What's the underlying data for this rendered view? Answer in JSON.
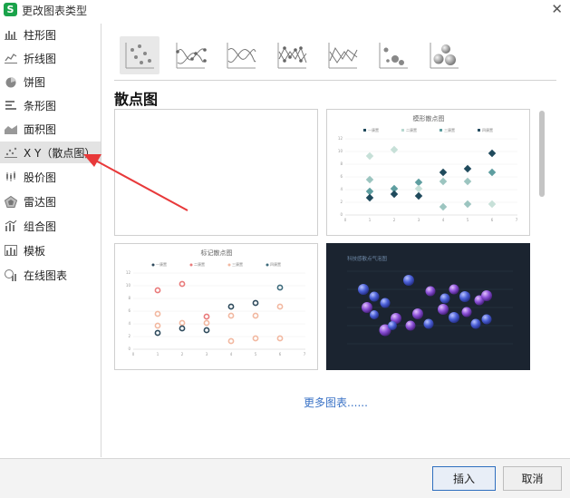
{
  "window": {
    "title": "更改图表类型",
    "app_icon": "S",
    "close_glyph": "✕"
  },
  "sidebar": {
    "items": [
      {
        "label": "柱形图",
        "icon": "column-chart-icon"
      },
      {
        "label": "折线图",
        "icon": "line-chart-icon"
      },
      {
        "label": "饼图",
        "icon": "pie-chart-icon"
      },
      {
        "label": "条形图",
        "icon": "bar-chart-icon"
      },
      {
        "label": "面积图",
        "icon": "area-chart-icon"
      },
      {
        "label": "X Y（散点图）",
        "icon": "scatter-chart-icon",
        "selected": true
      },
      {
        "label": "股价图",
        "icon": "stock-chart-icon"
      },
      {
        "label": "雷达图",
        "icon": "radar-chart-icon"
      },
      {
        "label": "组合图",
        "icon": "combo-chart-icon"
      },
      {
        "label": "模板",
        "icon": "template-icon"
      },
      {
        "label": "在线图表",
        "icon": "online-chart-icon"
      }
    ]
  },
  "chart_subtypes": [
    {
      "icon": "scatter-markers-icon",
      "selected": true
    },
    {
      "icon": "smooth-lines-markers-icon"
    },
    {
      "icon": "smooth-lines-icon"
    },
    {
      "icon": "straight-lines-markers-icon"
    },
    {
      "icon": "straight-lines-icon"
    },
    {
      "icon": "bubble-icon"
    },
    {
      "icon": "3d-bubble-icon"
    }
  ],
  "section_title": "散点图",
  "gallery": {
    "thumbnails": [
      {
        "name": "blank-scatter",
        "title": ""
      },
      {
        "name": "shadow-scatter",
        "title": "模形散点图",
        "legend": [
          "一康置",
          "二康置",
          "三康置",
          "四康置"
        ],
        "y_ticks": [
          "12",
          "10",
          "8",
          "6",
          "4",
          "2",
          "0"
        ],
        "x_ticks": [
          "0",
          "1",
          "2",
          "3",
          "4",
          "5",
          "6",
          "7"
        ],
        "colors": [
          "#1f4a5c",
          "#b7d8d0",
          "#5e9ea0",
          "#2a4f63"
        ]
      },
      {
        "name": "marker-scatter",
        "title": "标记散点图",
        "legend": [
          "一康置",
          "二康置",
          "三康置",
          "四康置"
        ],
        "y_ticks": [
          "12",
          "10",
          "8",
          "6",
          "4",
          "2",
          "0"
        ],
        "x_ticks": [
          "0",
          "1",
          "2",
          "3",
          "4",
          "5",
          "6",
          "7"
        ],
        "colors": [
          "#2e4a5c",
          "#e97a7a",
          "#f2b8a0",
          "#3e6b7c"
        ]
      },
      {
        "name": "tech-bubble-scatter",
        "title": "科技感散点气泡图",
        "colors": [
          "#4a5fd6",
          "#8a4fd6",
          "#1b2430"
        ]
      }
    ]
  },
  "more_link": "更多图表......",
  "footer": {
    "insert": "插入",
    "cancel": "取消"
  },
  "accent": {
    "primary_border": "#2f6fbf",
    "link": "#3b73c6",
    "arrow": "#e8393a"
  }
}
